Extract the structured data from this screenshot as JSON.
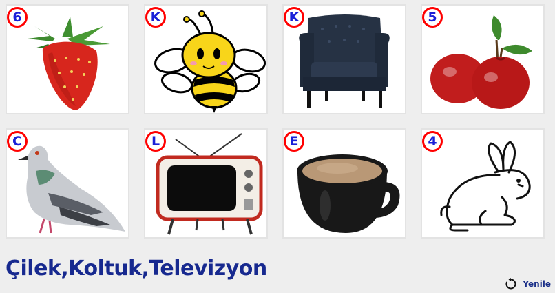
{
  "cards": [
    {
      "badge": "6",
      "icon": "strawberry-image"
    },
    {
      "badge": "K",
      "icon": "bee-image"
    },
    {
      "badge": "K",
      "icon": "armchair-image"
    },
    {
      "badge": "5",
      "icon": "apples-image"
    },
    {
      "badge": "C",
      "icon": "pigeon-image"
    },
    {
      "badge": "L",
      "icon": "television-image"
    },
    {
      "badge": "E",
      "icon": "tea-cup-image"
    },
    {
      "badge": "4",
      "icon": "rabbit-image"
    }
  ],
  "answer": "Çilek,Koltuk,Televizyon",
  "refresh": {
    "label": "Yenile",
    "icon": "refresh-icon"
  },
  "colors": {
    "badge_ring": "#ff0000",
    "badge_text": "#1a20d8",
    "answer_text": "#17298f",
    "background": "#eeeeee"
  }
}
